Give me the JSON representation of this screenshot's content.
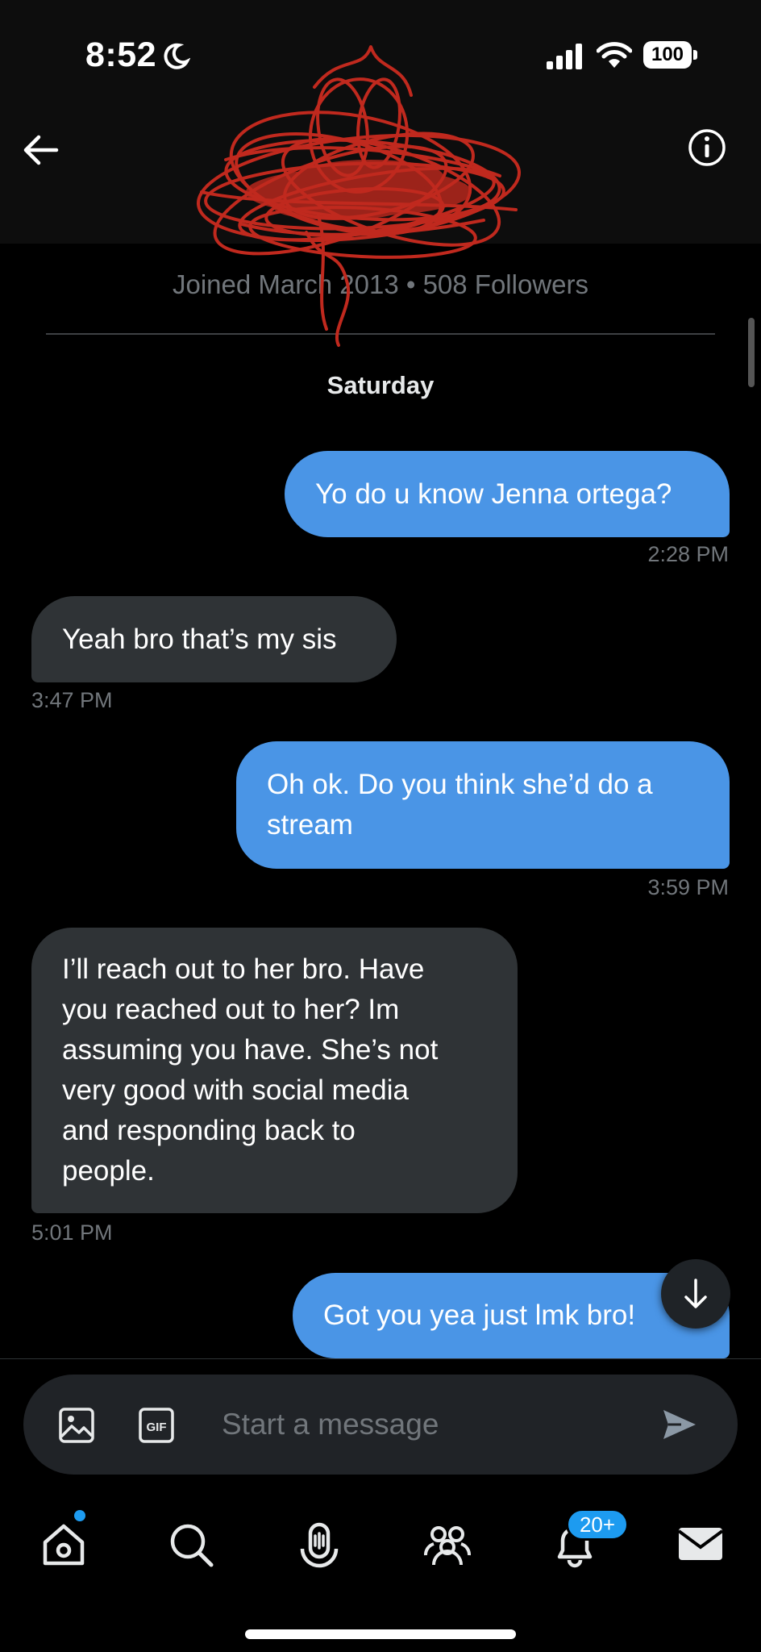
{
  "status_bar": {
    "time": "8:52",
    "battery": "100"
  },
  "header": {
    "profile_name": ""
  },
  "profile_meta": {
    "joined_text": "Joined March 2013 • 508 Followers"
  },
  "conversation": {
    "date_label": "Saturday",
    "messages": [
      {
        "direction": "sent",
        "text": "Yo do u know Jenna ortega?",
        "time": "2:28 PM"
      },
      {
        "direction": "received",
        "text": "Yeah bro that’s my sis",
        "time": "3:47 PM"
      },
      {
        "direction": "sent",
        "lines": [
          "Oh ok. Do you think she’d do a",
          "stream"
        ],
        "time": "3:59 PM"
      },
      {
        "direction": "received",
        "lines": [
          "I’ll reach out to her bro. Have",
          "you reached out to her? Im",
          "assuming you have.  She’s not",
          "very good with social media",
          "and responding back to",
          "people."
        ],
        "time": "5:01 PM"
      },
      {
        "direction": "sent",
        "text": "Got you yea just lmk bro!"
      }
    ]
  },
  "composer": {
    "placeholder": "Start a message"
  },
  "tabbar": {
    "notifications_badge": "20+"
  },
  "colors": {
    "sent_bubble": "#4a95e6",
    "received_bubble": "#2f3336",
    "accent": "#1d9bf0",
    "scribble": "#c0291e"
  },
  "icons": [
    "moon-icon",
    "signal-icon",
    "wifi-icon",
    "battery-icon",
    "back-arrow-icon",
    "info-icon",
    "arrow-down-icon",
    "image-icon",
    "gif-icon",
    "send-icon",
    "home-icon",
    "search-icon",
    "spaces-icon",
    "communities-icon",
    "bell-icon",
    "mail-icon"
  ]
}
